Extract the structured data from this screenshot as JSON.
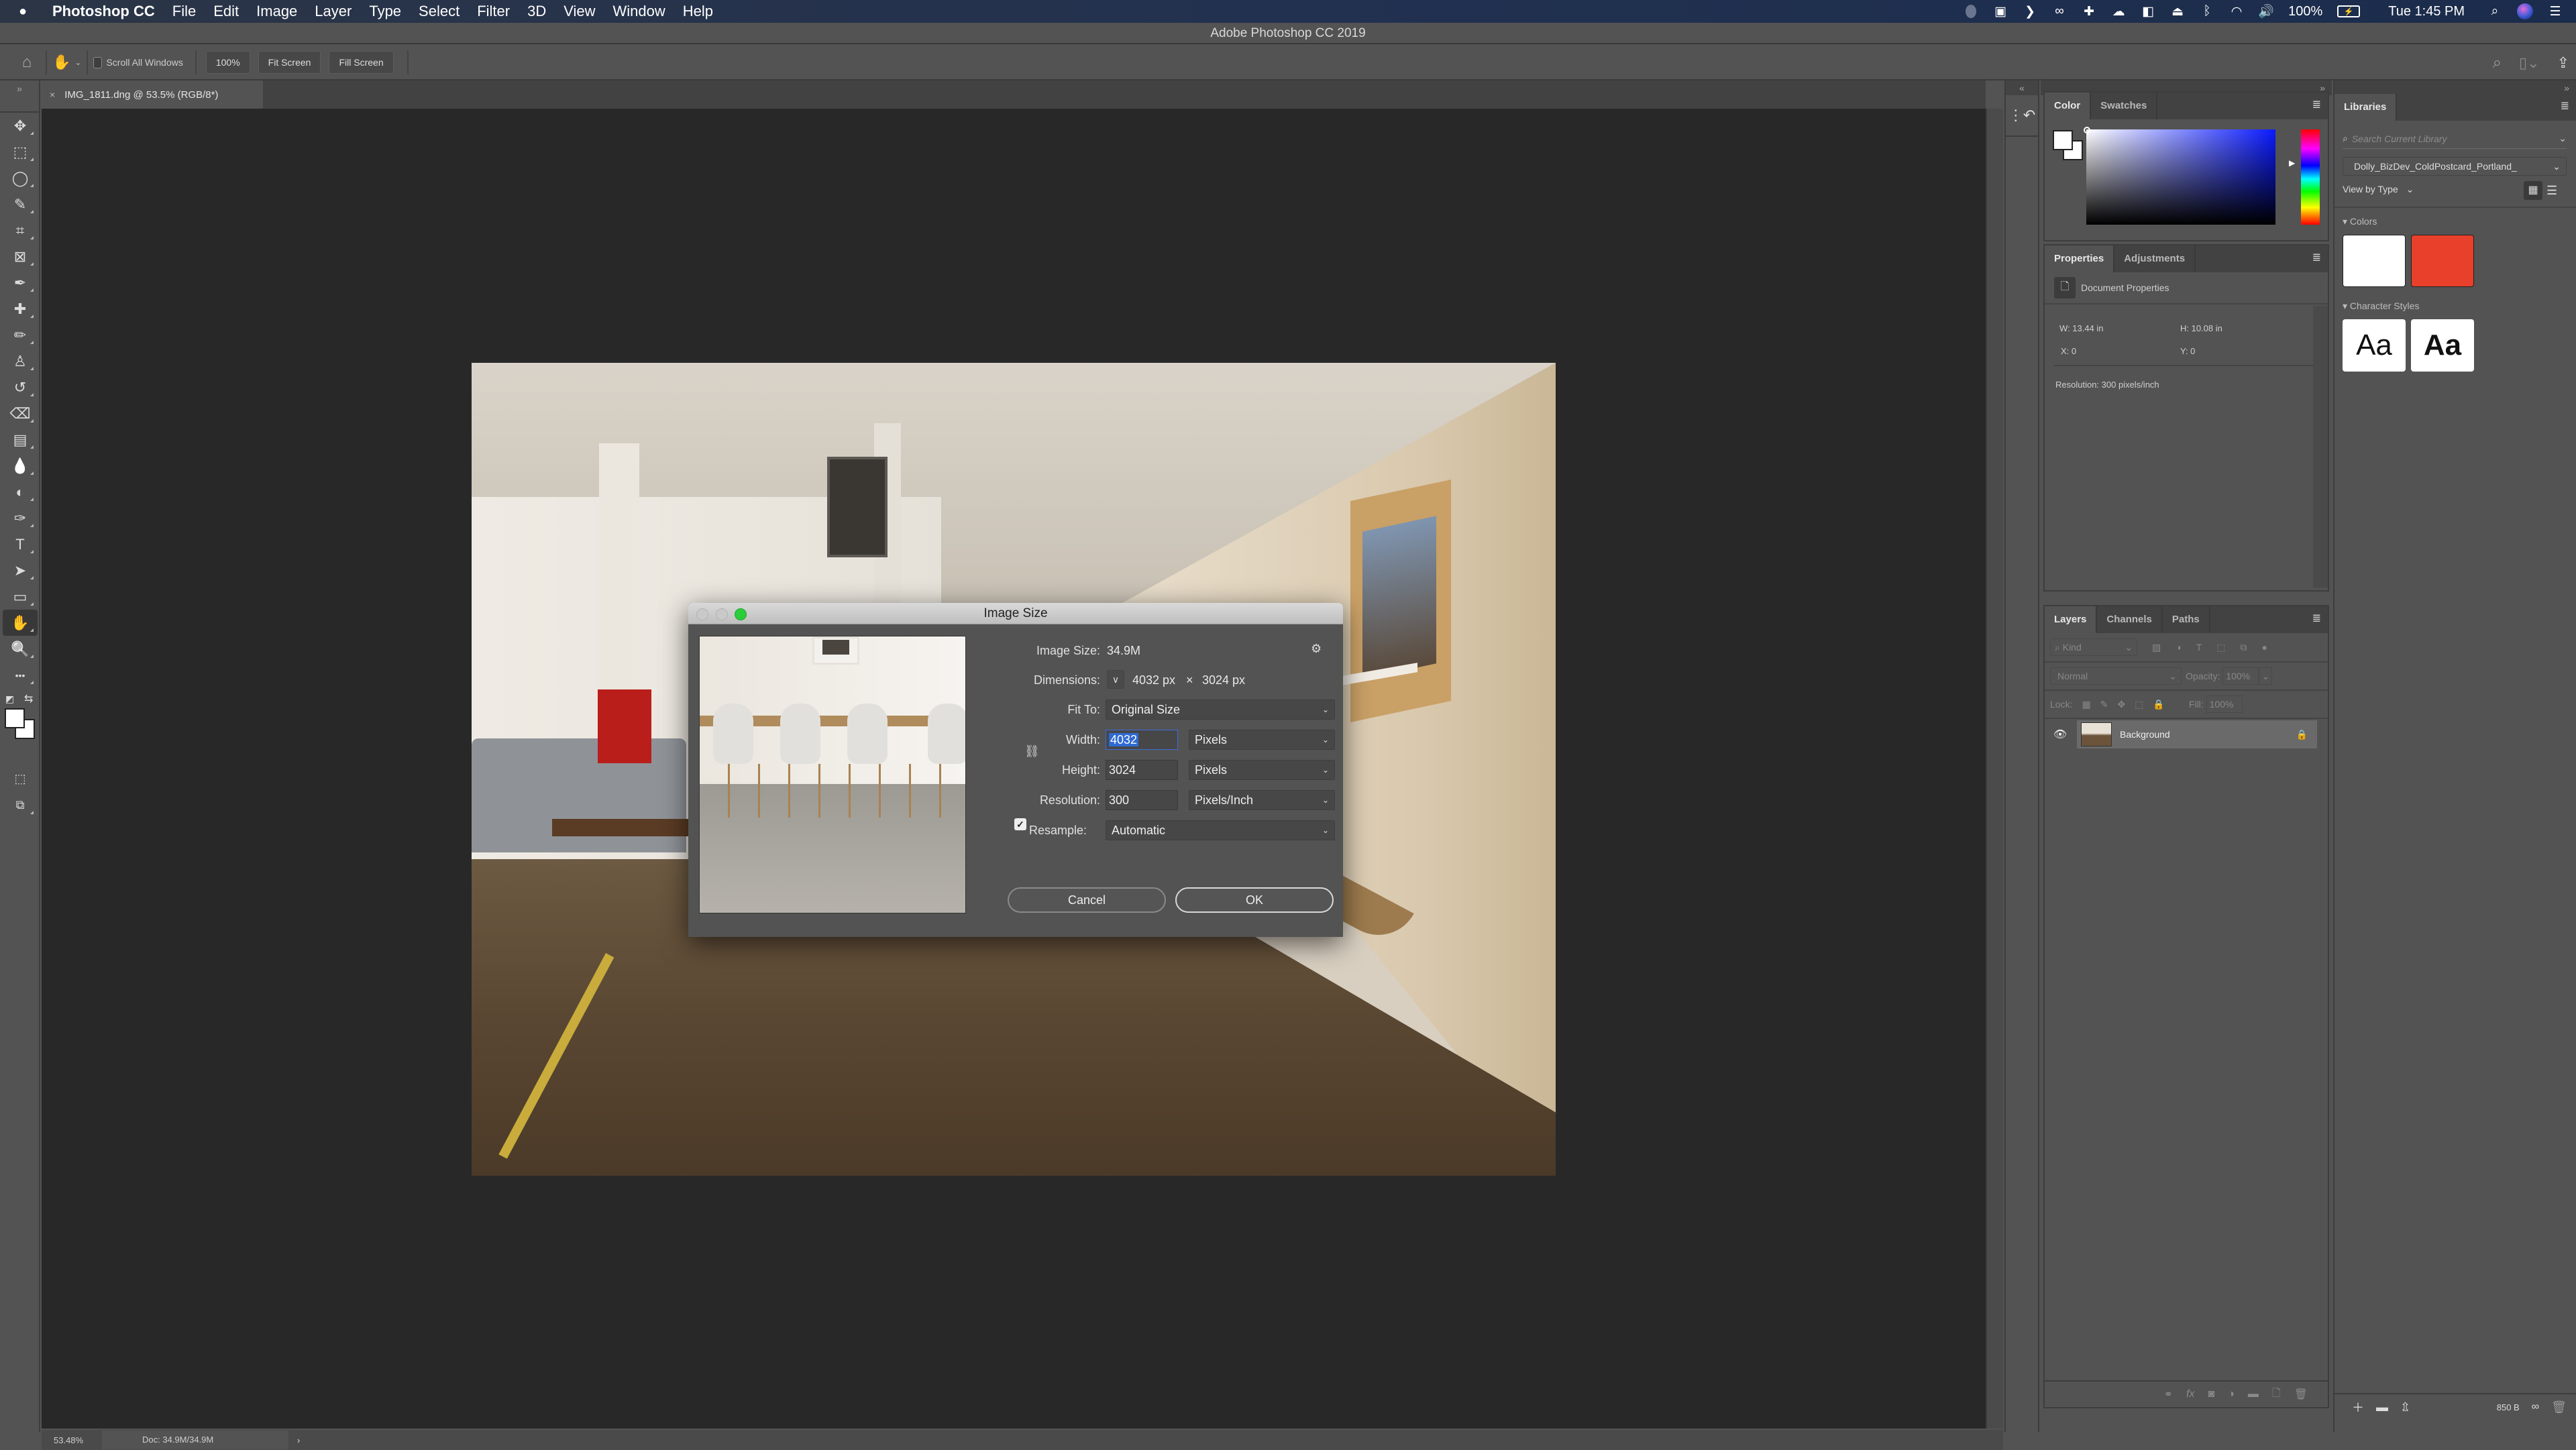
{
  "menubar": {
    "app_name": "Photoshop CC",
    "items": [
      "File",
      "Edit",
      "Image",
      "Layer",
      "Type",
      "Select",
      "Filter",
      "3D",
      "View",
      "Window",
      "Help"
    ],
    "battery": "100%",
    "clock": "Tue 1:45 PM"
  },
  "window_title": "Adobe Photoshop CC 2019",
  "options_bar": {
    "scroll_all_windows": "Scroll All Windows",
    "zoom_100": "100%",
    "fit_screen": "Fit Screen",
    "fill_screen": "Fill Screen"
  },
  "document_tab": {
    "close": "×",
    "title": "IMG_1811.dng @ 53.5% (RGB/8*)"
  },
  "toolbar": {
    "tools": [
      {
        "name": "move-tool",
        "glyph": "✥"
      },
      {
        "name": "marquee-tool",
        "glyph": "⬚"
      },
      {
        "name": "lasso-tool",
        "glyph": "◯"
      },
      {
        "name": "quick-selection-tool",
        "glyph": "✎"
      },
      {
        "name": "crop-tool",
        "glyph": "⌗"
      },
      {
        "name": "frame-tool",
        "glyph": "⊠"
      },
      {
        "name": "eyedropper-tool",
        "glyph": "✒"
      },
      {
        "name": "healing-brush-tool",
        "glyph": "✚"
      },
      {
        "name": "brush-tool",
        "glyph": "✏"
      },
      {
        "name": "clone-stamp-tool",
        "glyph": "♙"
      },
      {
        "name": "history-brush-tool",
        "glyph": "↺"
      },
      {
        "name": "eraser-tool",
        "glyph": "⌫"
      },
      {
        "name": "gradient-tool",
        "glyph": "▤"
      },
      {
        "name": "blur-tool",
        "glyph": "💧"
      },
      {
        "name": "dodge-tool",
        "glyph": "◐"
      },
      {
        "name": "pen-tool",
        "glyph": "✑"
      },
      {
        "name": "type-tool",
        "glyph": "T"
      },
      {
        "name": "path-selection-tool",
        "glyph": "➤"
      },
      {
        "name": "rectangle-tool",
        "glyph": "▭"
      },
      {
        "name": "hand-tool",
        "glyph": "✋"
      },
      {
        "name": "zoom-tool",
        "glyph": "🔍"
      },
      {
        "name": "edit-toolbar",
        "glyph": "•••"
      }
    ]
  },
  "status_bar": {
    "zoom": "53.48%",
    "doc": "Doc: 34.9M/34.9M",
    "arrow": "›"
  },
  "color_panel": {
    "tabs": [
      "Color",
      "Swatches"
    ],
    "foreground": "#ffffff",
    "background": "#ffffff",
    "hue_color": "#0a1aff"
  },
  "properties_panel": {
    "tabs": [
      "Properties",
      "Adjustments"
    ],
    "section": "Document Properties",
    "w": "W:  13.44 in",
    "h": "H:  10.08 in",
    "x": "X:  0",
    "y": "Y:  0",
    "resolution": "Resolution: 300 pixels/inch"
  },
  "layers_panel": {
    "tabs": [
      "Layers",
      "Channels",
      "Paths"
    ],
    "filter_kind": "Kind",
    "blend_mode": "Normal",
    "opacity_label": "Opacity:",
    "opacity": "100%",
    "lock_label": "Lock:",
    "fill_label": "Fill:",
    "fill": "100%",
    "layers": [
      {
        "name": "Background",
        "visible": true,
        "locked": true
      }
    ]
  },
  "libraries_panel": {
    "tab": "Libraries",
    "search_placeholder": "Search Current Library",
    "library_name": "Dolly_BizDev_ColdPostcard_Portland_",
    "view_by": "View by Type",
    "colors_label": "Colors",
    "colors": [
      "#ffffff",
      "#e8402a"
    ],
    "char_styles_label": "Character Styles",
    "char_styles": [
      "Aa",
      "Aa"
    ],
    "footer_size": "850 B"
  },
  "image_size_dialog": {
    "title": "Image Size",
    "image_size_label": "Image Size:",
    "image_size": "34.9M",
    "dimensions_label": "Dimensions:",
    "dim_width": "4032 px",
    "dim_times": "×",
    "dim_height": "3024 px",
    "fit_to_label": "Fit To:",
    "fit_to": "Original Size",
    "width_label": "Width:",
    "width": "4032",
    "width_unit": "Pixels",
    "height_label": "Height:",
    "height": "3024",
    "height_unit": "Pixels",
    "resolution_label": "Resolution:",
    "resolution": "300",
    "resolution_unit": "Pixels/Inch",
    "resample_label": "Resample:",
    "resample_checked": true,
    "resample": "Automatic",
    "cancel": "Cancel",
    "ok": "OK"
  }
}
